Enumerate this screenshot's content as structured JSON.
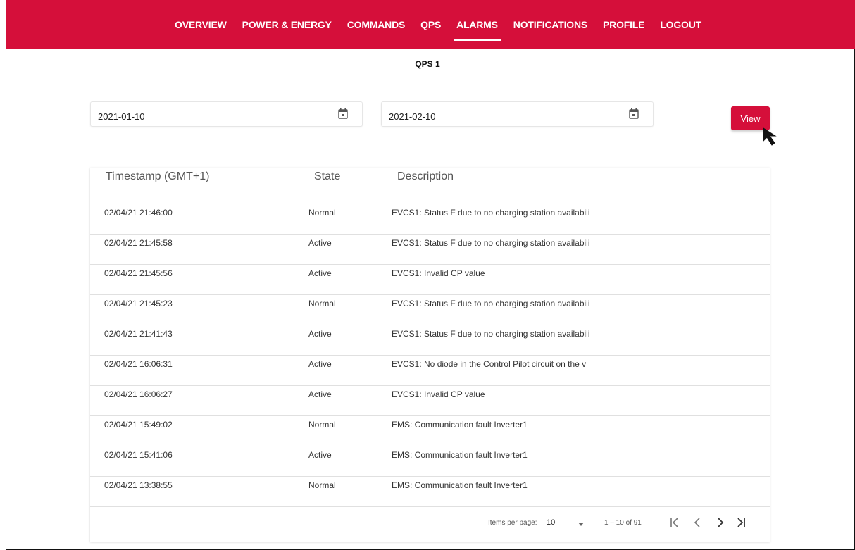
{
  "nav": {
    "items": [
      "OVERVIEW",
      "POWER & ENERGY",
      "COMMANDS",
      "QPS",
      "ALARMS",
      "NOTIFICATIONS",
      "PROFILE",
      "LOGOUT"
    ],
    "active": "ALARMS"
  },
  "page": {
    "title": "QPS 1"
  },
  "filters": {
    "from_date": "2021-01-10",
    "to_date": "2021-02-10",
    "view_label": "View"
  },
  "table": {
    "columns": [
      "Timestamp (GMT+1)",
      "State",
      "Description"
    ],
    "rows": [
      {
        "timestamp": "02/04/21 21:46:00",
        "state": "Normal",
        "description": "EVCS1: Status F due to no charging station availabili"
      },
      {
        "timestamp": "02/04/21 21:45:58",
        "state": "Active",
        "description": "EVCS1: Status F due to no charging station availabili"
      },
      {
        "timestamp": "02/04/21 21:45:56",
        "state": "Active",
        "description": "EVCS1: Invalid CP value"
      },
      {
        "timestamp": "02/04/21 21:45:23",
        "state": "Normal",
        "description": "EVCS1: Status F due to no charging station availabili"
      },
      {
        "timestamp": "02/04/21 21:41:43",
        "state": "Active",
        "description": "EVCS1: Status F due to no charging station availabili"
      },
      {
        "timestamp": "02/04/21 16:06:31",
        "state": "Active",
        "description": "EVCS1: No diode in the Control Pilot circuit on the v"
      },
      {
        "timestamp": "02/04/21 16:06:27",
        "state": "Active",
        "description": "EVCS1: Invalid CP value"
      },
      {
        "timestamp": "02/04/21 15:49:02",
        "state": "Normal",
        "description": "EMS: Communication fault Inverter1"
      },
      {
        "timestamp": "02/04/21 15:41:06",
        "state": "Active",
        "description": "EMS: Communication fault Inverter1"
      },
      {
        "timestamp": "02/04/21 13:38:55",
        "state": "Normal",
        "description": "EMS: Communication fault Inverter1"
      }
    ]
  },
  "paginator": {
    "items_per_page_label": "Items per page:",
    "items_per_page": "10",
    "range_label": "1 – 10 of 91"
  },
  "colors": {
    "brand": "#d50f3a"
  },
  "icons": [
    "calendar-icon",
    "first-page-icon",
    "prev-page-icon",
    "next-page-icon",
    "last-page-icon",
    "mouse-cursor-icon"
  ]
}
